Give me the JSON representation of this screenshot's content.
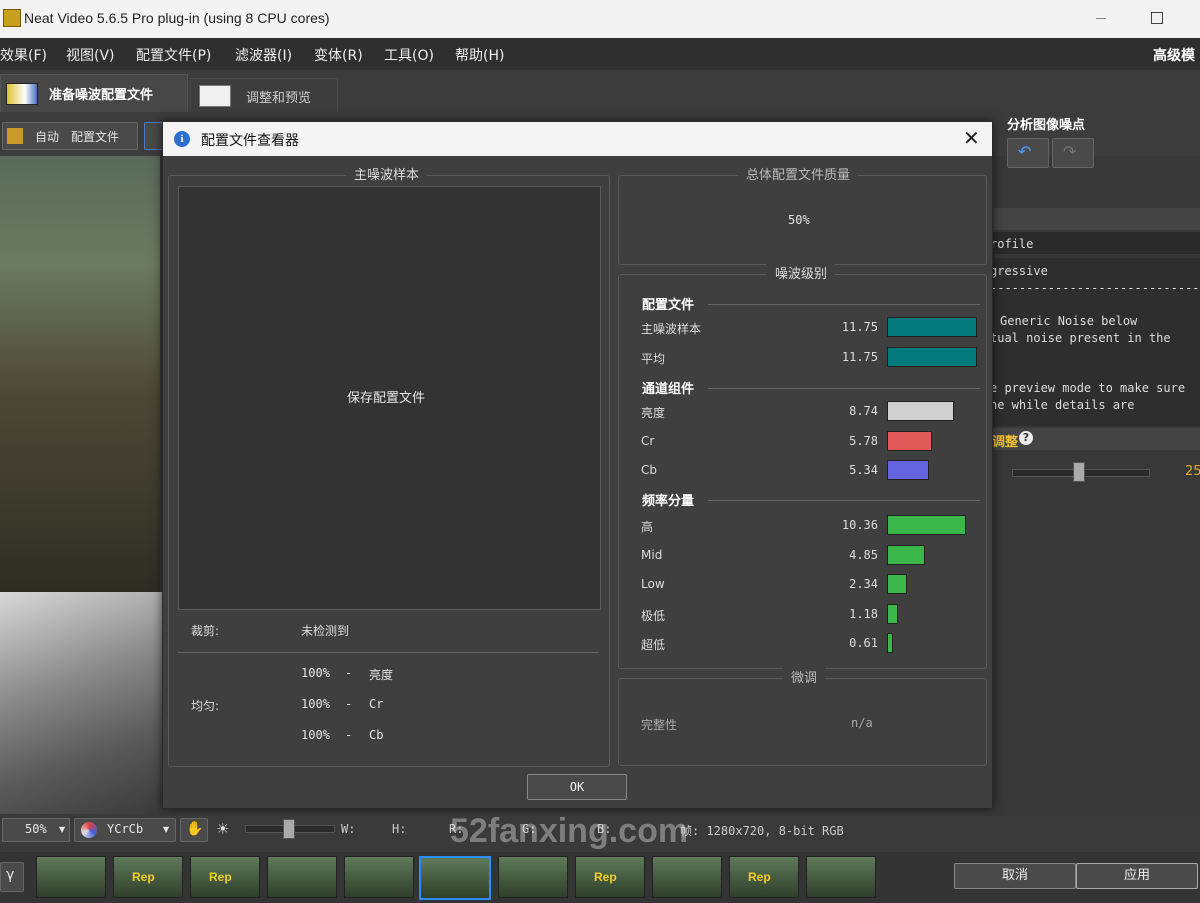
{
  "window": {
    "title": "Neat Video 5.6.5 Pro plug-in (using 8 CPU cores)"
  },
  "menu": {
    "items": [
      "效果(F)",
      "视图(V)",
      "配置文件(P)",
      "滤波器(I)",
      "变体(R)",
      "工具(O)",
      "帮助(H)"
    ],
    "right_label": "高级模"
  },
  "tabs": {
    "prepare": "准备噪波配置文件",
    "adjust": "调整和预览"
  },
  "toolbar": {
    "auto": "自动",
    "profile": "配置文件"
  },
  "right_panel": {
    "header": "分析图像噪点",
    "lines": [
      "rofile",
      "gressive",
      "--------------------------------",
      "Generic Noise below",
      "tual noise present in the",
      "e preview mode to make sure",
      "ne while details are"
    ],
    "section_label": "调整",
    "slider_value": "25"
  },
  "dialog": {
    "title": "配置文件查看器",
    "close": "✕",
    "left_group": {
      "title": "主噪波样本",
      "sample_text": "保存配置文件",
      "clip_label": "裁剪:",
      "clip_value": "未检测到",
      "uniform_label": "均匀:",
      "uniform_rows": [
        {
          "value": "100%",
          "dash": "-",
          "channel": "亮度"
        },
        {
          "value": "100%",
          "dash": "-",
          "channel": "Cr"
        },
        {
          "value": "100%",
          "dash": "-",
          "channel": "Cb"
        }
      ]
    },
    "quality_group": {
      "title": "总体配置文件质量",
      "value": "50%"
    },
    "noise_group": {
      "title": "噪波级别",
      "profile_section": "配置文件",
      "profile_rows": [
        {
          "label": "主噪波样本",
          "value": "11.75",
          "fraction": 1.0
        },
        {
          "label": "平均",
          "value": "11.75",
          "fraction": 1.0
        }
      ],
      "channel_section": "通道组件",
      "channel_rows": [
        {
          "label": "亮度",
          "value": "8.74",
          "fraction": 0.74
        },
        {
          "label": "Cr",
          "value": "5.78",
          "fraction": 0.49
        },
        {
          "label": "Cb",
          "value": "5.34",
          "fraction": 0.45
        }
      ],
      "freq_section": "频率分量",
      "freq_rows": [
        {
          "label": "高",
          "value": "10.36",
          "fraction": 0.88
        },
        {
          "label": "Mid",
          "value": "4.85",
          "fraction": 0.41
        },
        {
          "label": "Low",
          "value": "2.34",
          "fraction": 0.2
        },
        {
          "label": "极低",
          "value": "1.18",
          "fraction": 0.1
        },
        {
          "label": "超低",
          "value": "0.61",
          "fraction": 0.05
        }
      ]
    },
    "tune_group": {
      "title": "微调",
      "label": "完整性",
      "value": "n/a"
    },
    "ok": "OK"
  },
  "colors": {
    "teal": "#007a7a",
    "luma": "#d0d0d0",
    "cr": "#e05858",
    "cb": "#6464e0",
    "green": "#3cb84a"
  },
  "status_bar": {
    "zoom": "50%",
    "colorspace": "YCrCb",
    "w": "W:",
    "h": "H:",
    "r": "R:",
    "g": "G:",
    "b": "B:",
    "frame_info": "帧: 1280x720, 8-bit RGB"
  },
  "filmstrip": {
    "rep": "Rep"
  },
  "actions": {
    "cancel": "取消",
    "apply": "应用"
  },
  "watermark": "52fanxing.com"
}
